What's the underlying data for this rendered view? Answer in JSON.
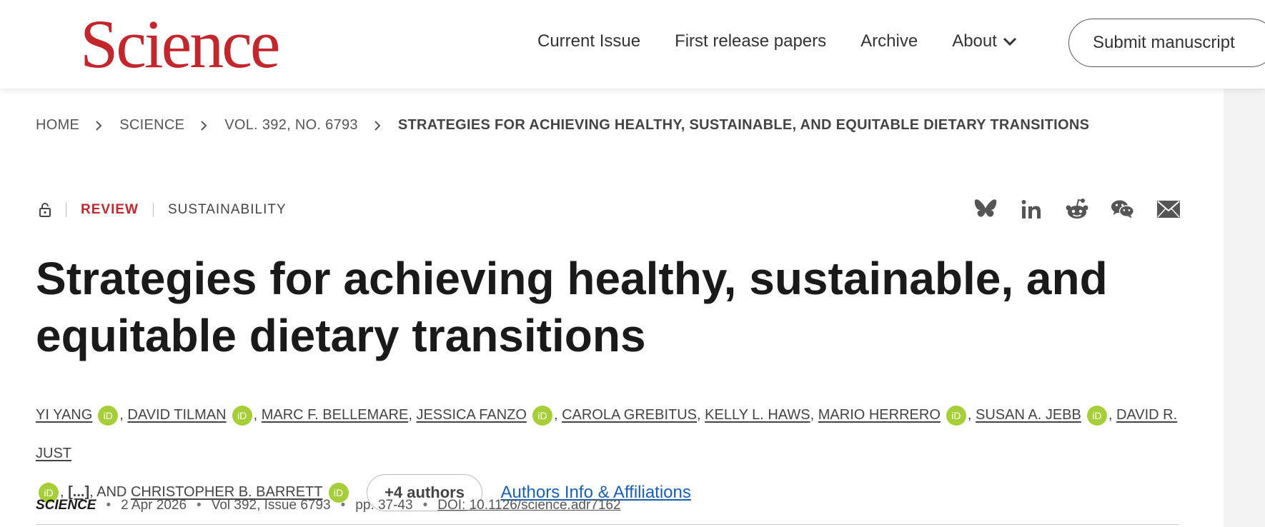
{
  "header": {
    "logo": "Science",
    "nav": [
      "Current Issue",
      "First release papers",
      "Archive"
    ],
    "about_label": "About",
    "submit_label": "Submit manuscript"
  },
  "breadcrumb": {
    "items": [
      "HOME",
      "SCIENCE",
      "VOL. 392, NO. 6793"
    ],
    "current": "STRATEGIES FOR ACHIEVING HEALTHY, SUSTAINABLE, AND EQUITABLE DIETARY TRANSITIONS"
  },
  "article": {
    "type": "REVIEW",
    "subject": "SUSTAINABILITY",
    "title": "Strategies for achieving healthy, sustainable, and equitable dietary transitions",
    "authors": [
      {
        "name": "YI YANG",
        "orcid": true
      },
      {
        "name": "DAVID TILMAN",
        "orcid": true
      },
      {
        "name": "MARC F. BELLEMARE",
        "orcid": false
      },
      {
        "name": "JESSICA FANZO",
        "orcid": true
      },
      {
        "name": "CAROLA GREBITUS",
        "orcid": false
      },
      {
        "name": "KELLY L. HAWS",
        "orcid": false
      },
      {
        "name": "MARIO HERRERO",
        "orcid": true
      },
      {
        "name": "SUSAN A. JEBB",
        "orcid": true
      },
      {
        "name": "DAVID R. JUST",
        "orcid": true
      }
    ],
    "ellipsis": "[...]",
    "and_label": "AND",
    "last_author": "CHRISTOPHER B. BARRETT",
    "orcid_glyph": "iD",
    "more_authors_label": "+4 authors",
    "affiliations_label": "Authors Info & Affiliations"
  },
  "meta": {
    "journal": "SCIENCE",
    "date": "2 Apr 2026",
    "volume": "Vol 392, Issue 6793",
    "pages": "pp. 37-43",
    "doi": "DOI: 10.1126/science.adr7162"
  },
  "share_icons": [
    "bluesky-icon",
    "linkedin-icon",
    "reddit-icon",
    "wechat-icon",
    "email-icon"
  ],
  "colors": {
    "brand": "#c1272d",
    "orcid": "#a6ce39",
    "link": "#1a5fb4"
  }
}
